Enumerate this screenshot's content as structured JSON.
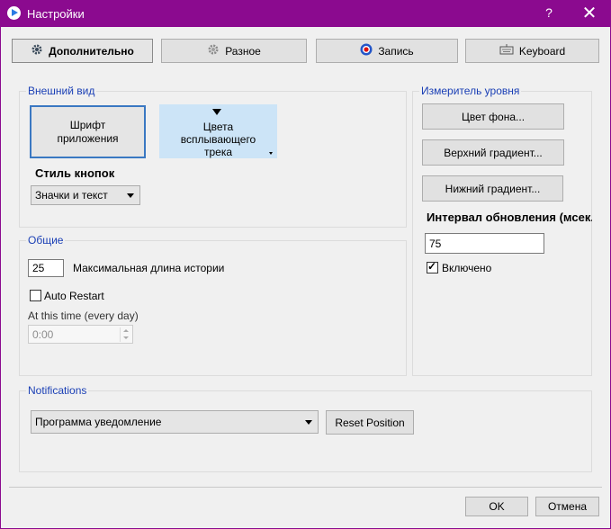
{
  "window": {
    "title": "Настройки",
    "help": "?",
    "close": "✕"
  },
  "tabs": [
    {
      "label": "Дополнительно",
      "icon": "gear-icon"
    },
    {
      "label": "Разное",
      "icon": "gear-grey-icon"
    },
    {
      "label": "Запись",
      "icon": "record-icon"
    },
    {
      "label": "Keyboard",
      "icon": "keyboard-icon"
    }
  ],
  "appearance": {
    "title": "Внешний вид",
    "font_button": "Шрифт приложения",
    "popup_colors_button": "Цвета всплывающего трека",
    "button_style_label": "Стиль кнопок",
    "button_style_value": "Значки и текст"
  },
  "general": {
    "title": "Общие",
    "history_length": "25",
    "history_label": "Максимальная длина истории",
    "auto_restart_label": "Auto Restart",
    "auto_restart_checked": false,
    "at_time_label": "At this time (every day)",
    "time_value": "0:00"
  },
  "level_meter": {
    "title": "Измеритель уровня",
    "bg_color_button": "Цвет фона...",
    "top_gradient_button": "Верхний градиент...",
    "bottom_gradient_button": "Нижний градиент...",
    "interval_label": "Интервал обновления (мсек.)",
    "interval_value": "75",
    "enabled_label": "Включено",
    "enabled_checked": true
  },
  "notifications": {
    "title": "Notifications",
    "program_value": "Программа уведомление",
    "reset_button": "Reset Position"
  },
  "footer": {
    "ok": "OK",
    "cancel": "Отмена"
  }
}
